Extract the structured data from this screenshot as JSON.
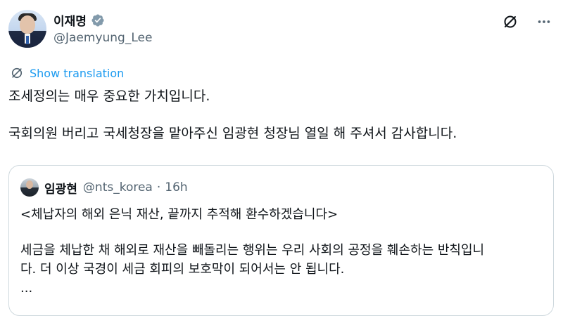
{
  "author": {
    "display_name": "이재명",
    "handle": "@Jaemyung_Lee",
    "verified": true
  },
  "icons": {
    "verified": "verified-badge-icon",
    "grok": "grok-icon",
    "more": "more-dots-icon",
    "translate": "globe-translate-icon"
  },
  "colors": {
    "accent": "#1d9bf0",
    "text": "#0f1419",
    "muted": "#536471",
    "border": "#cfd9de"
  },
  "translate_label": "Show translation",
  "tweet": {
    "line1": "조세정의는 매우 중요한 가치입니다.",
    "line2": "국회의원 버리고 국세청장을 맡아주신 임광현 청장님 열일 해 주셔서 감사합니다."
  },
  "quote": {
    "display_name": "임광현",
    "handle": "@nts_korea",
    "separator": "·",
    "time": "16h",
    "line1": "<체납자의 해외 은닉 재산, 끝까지 추적해 환수하겠습니다>",
    "line2": "세금을 체납한 채 해외로 재산을 빼돌리는 행위는 우리 사회의 공정을 훼손하는 반칙입니",
    "line3": "다. 더 이상 국경이 세금 회피의 보호막이 되어서는 안 됩니다.",
    "line4": "..."
  }
}
